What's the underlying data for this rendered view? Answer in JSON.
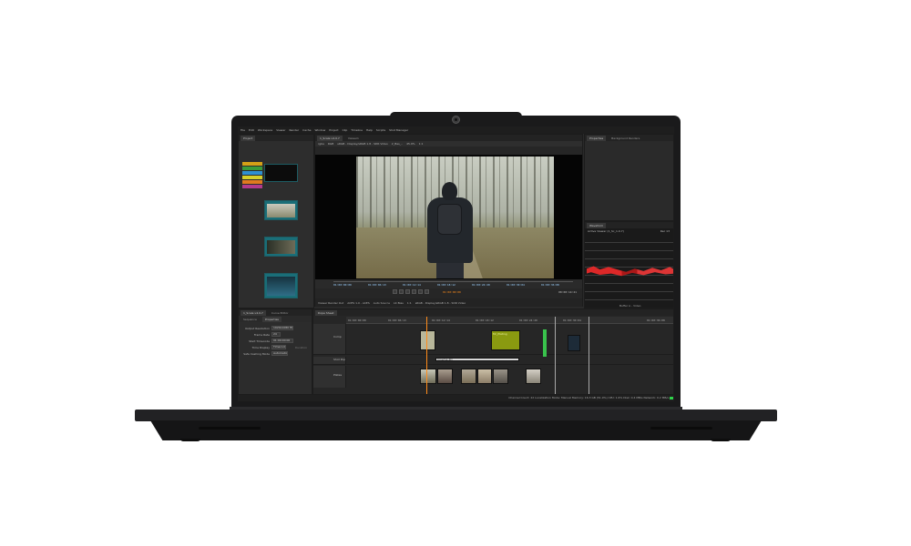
{
  "app": {
    "menus": [
      "File",
      "Edit",
      "Workspace",
      "Viewer",
      "Render",
      "Cache",
      "Window",
      "Project",
      "Clip",
      "Timeline",
      "Help",
      "Scripts",
      "Shot Manager"
    ]
  },
  "project_panel": {
    "tab": "Project",
    "swatch_colors": [
      "#d4a017",
      "#3a9b3a",
      "#2f8fd1",
      "#d6d02a",
      "#e07a1f",
      "#b33a8c"
    ]
  },
  "viewer": {
    "tabs": [
      "1_Scale v4.0.7",
      "Viewer1"
    ],
    "toolbar": [
      "rgba",
      "RGB",
      "sRGB - Display/sRGB 1.8 - SDR Video",
      "2_Bas_..",
      "45.9%",
      "1:1"
    ],
    "timecodes": [
      "01:00:00:00",
      "01:00:06:13",
      "01:00:12:14",
      "01:00:18:12",
      "01:00:24:20",
      "01:00:30:04",
      "01:00:36:08"
    ],
    "playhead_timecode": "01:00:00:00",
    "end_timecode": "00:00:14:21",
    "lower_bar": [
      "Viewer Render Out",
      "ACES 1.0 - ACES",
      "Auto Source",
      "LK Bias",
      "1:1",
      "sRGB - Display/sRGB 1.8 - SDR Video"
    ]
  },
  "properties_panel": {
    "tabs": [
      "Properties",
      "Background Renders"
    ]
  },
  "waveform": {
    "tab": "Waveform",
    "header_left": "Active Viewer (1_Sc_1.0.7)",
    "header_right": "Rec 13",
    "footer": "Buffer A - Video"
  },
  "sequence": {
    "tabs": [
      "1_Scale v4.0.7",
      "Curve Editor"
    ],
    "subtabs": [
      "Sequence",
      "Properties"
    ],
    "fields": [
      {
        "label": "Output Resolution",
        "value": "1920x1080 HD_1080"
      },
      {
        "label": "Frame Rate",
        "value": "24"
      },
      {
        "label": "Start Timecode",
        "value": "01:00:00:00"
      },
      {
        "label": "Time Display",
        "value": "Timecode"
      },
      {
        "label": "Safe Cashing Mode",
        "value": "Automatic"
      }
    ],
    "extra": "Duration"
  },
  "timeline": {
    "tab": "Dope Sheet",
    "ruler": [
      "01:00:00:00",
      "01:00:06:13",
      "01:00:12:14",
      "01:00:18:12",
      "01:00:24:20",
      "01:00:30:04",
      "01:00:36:08"
    ],
    "tracks": [
      "Comp",
      "Shot Pop",
      "Plates"
    ],
    "clip_label": "Mr_Plating",
    "bar_label": "Cinema 4D"
  },
  "status": {
    "text": "Channel Count: 22  Localization Mode: Manual  Memory: 16.3 GB (51.0%)  CPU: 1.6%  Disk: 0.4 MB/s  Network: 0.2 MB/s"
  }
}
